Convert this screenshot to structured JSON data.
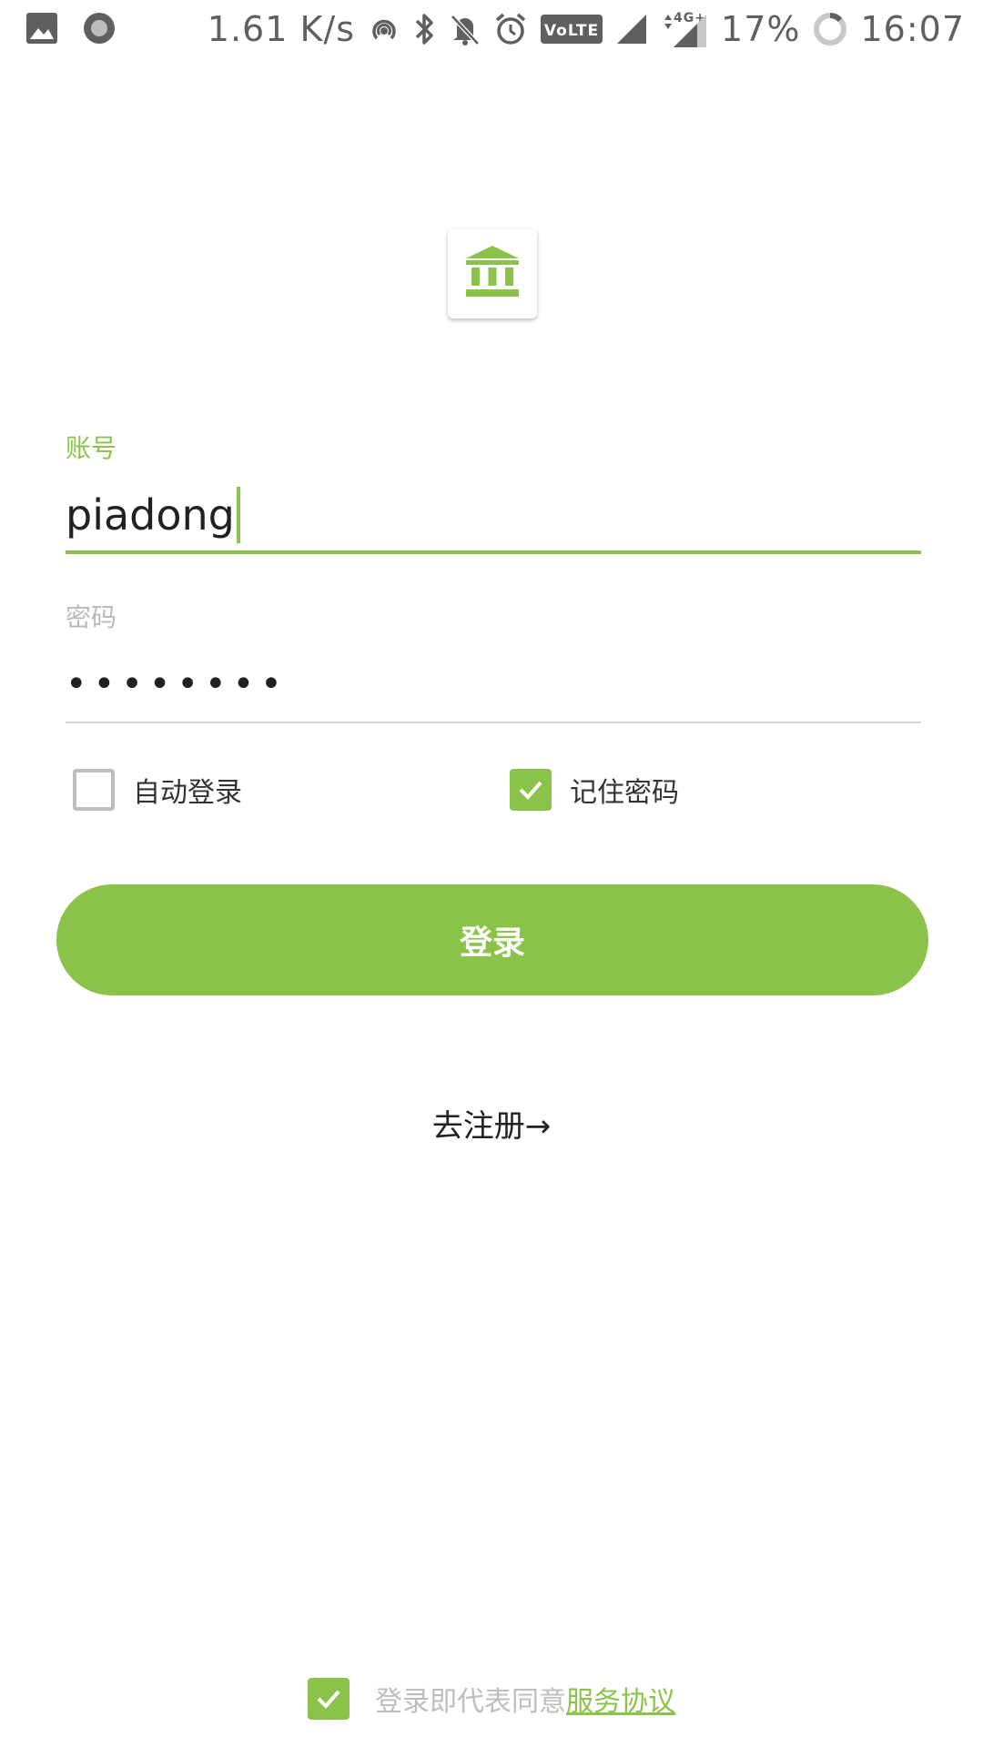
{
  "status_bar": {
    "left_icons": [
      "image-icon",
      "record-icon"
    ],
    "network_speed": "1.61 K/s",
    "right_icons": [
      "hotspot-icon",
      "bluetooth-icon",
      "mute-icon",
      "alarm-icon",
      "volte-icon",
      "signal-icon",
      "4g-signal-icon"
    ],
    "volte_text": "VoLTE",
    "network_type": "4G+",
    "battery": "17%",
    "time": "16:07"
  },
  "colors": {
    "accent": "#8bc34a",
    "text": "#212121",
    "hint": "#b9b9b9"
  },
  "logo": {
    "icon": "bank-icon"
  },
  "account": {
    "label": "账号",
    "value": "piadong"
  },
  "password": {
    "label": "密码",
    "masked_value": "••••••••"
  },
  "options": {
    "auto_login": {
      "label": "自动登录",
      "checked": false
    },
    "remember_password": {
      "label": "记住密码",
      "checked": true
    }
  },
  "login_button": {
    "label": "登录"
  },
  "register": {
    "label": "去注册→"
  },
  "agreement": {
    "checked": true,
    "text": "登录即代表同意",
    "link": "服务协议"
  }
}
